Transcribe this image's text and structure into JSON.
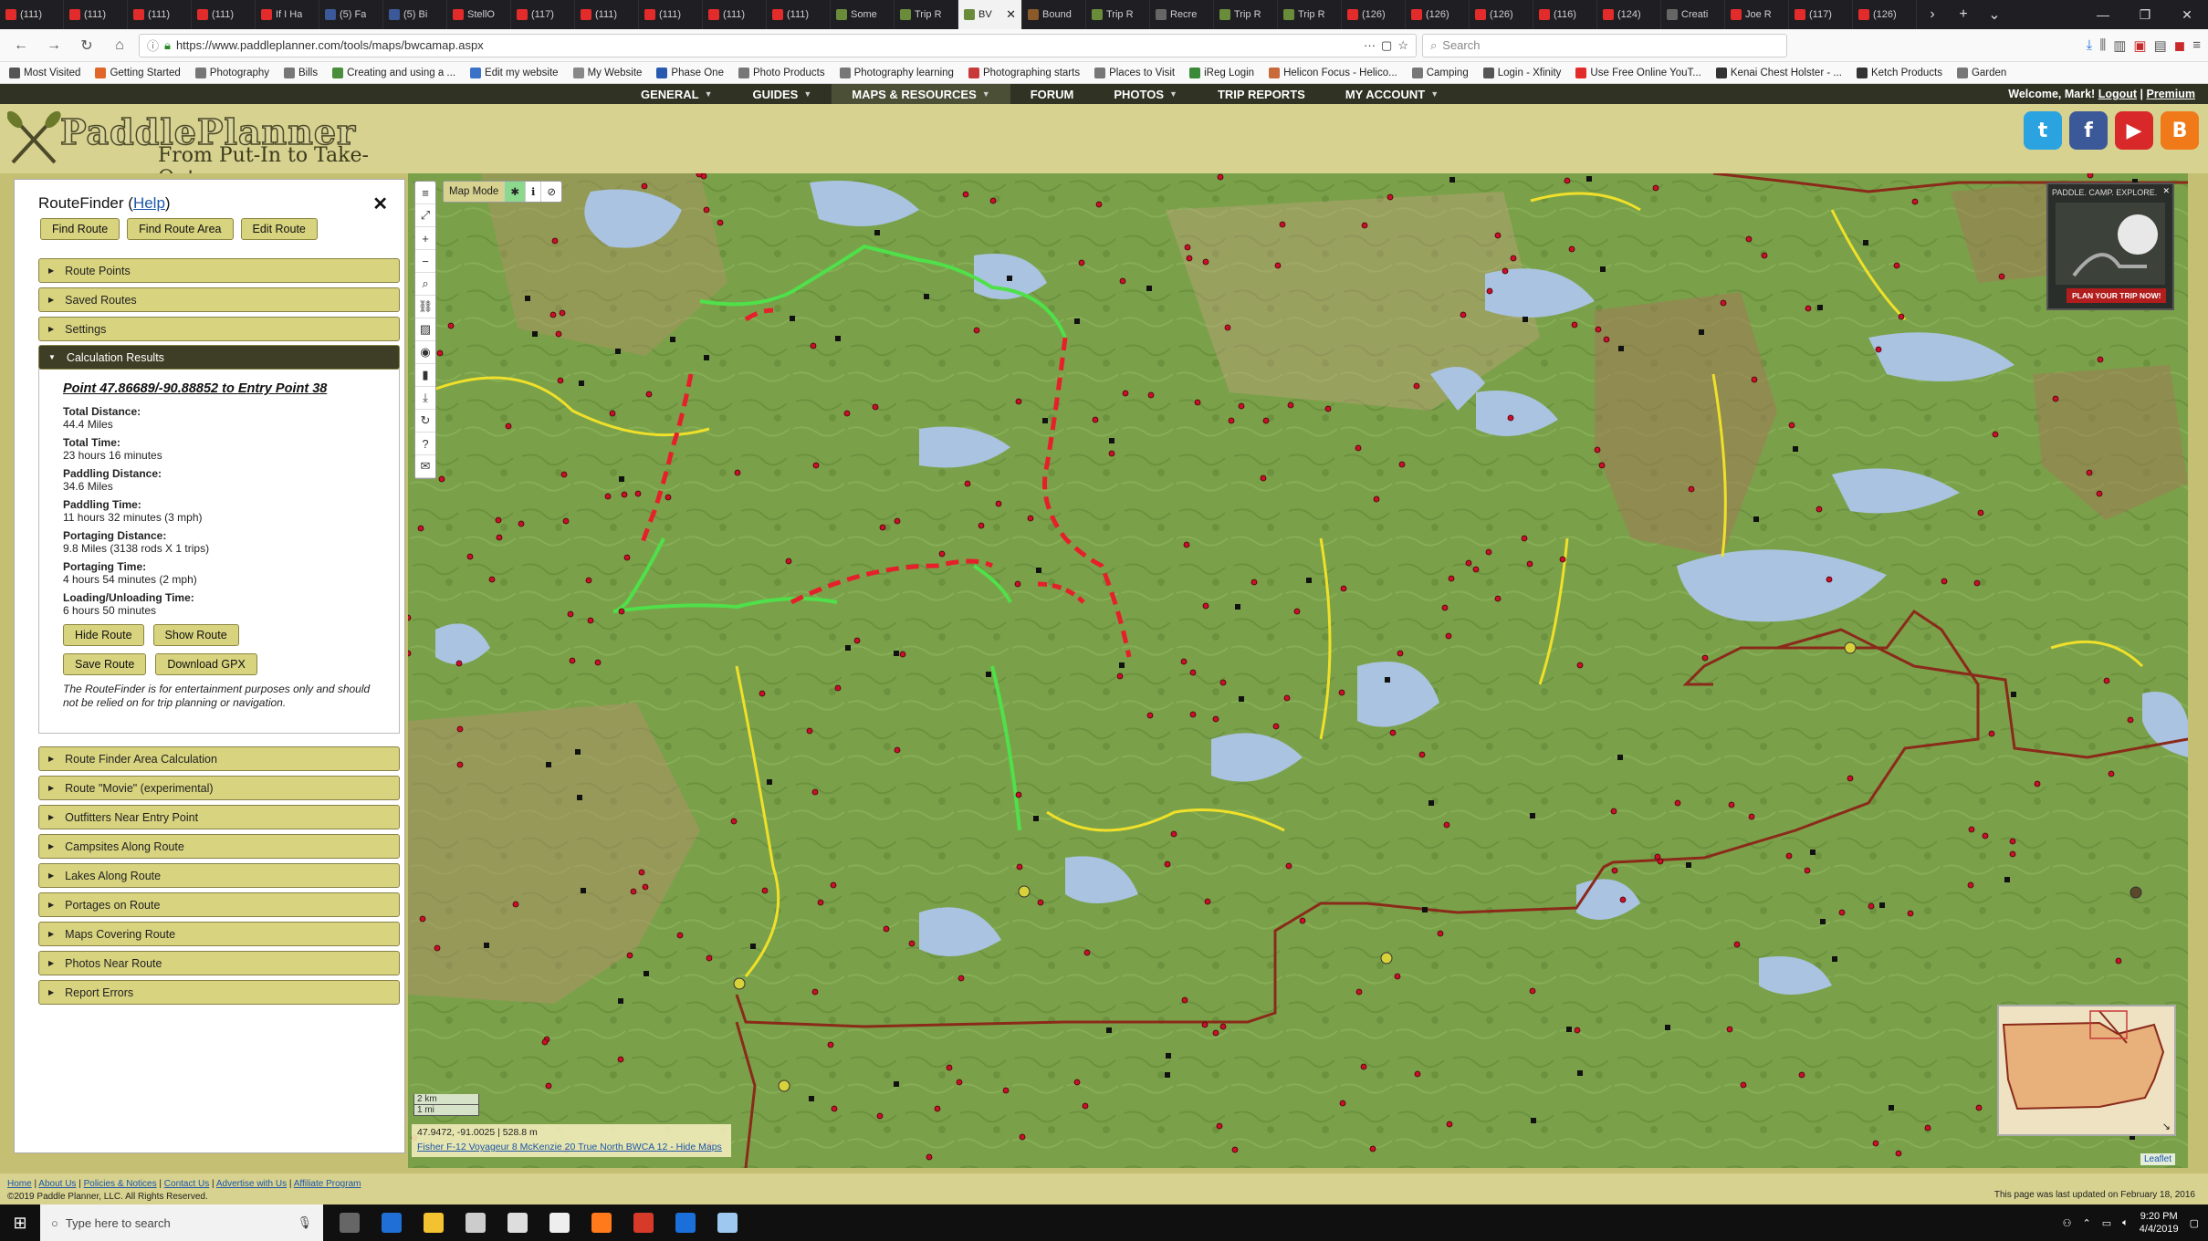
{
  "browser": {
    "tabs": [
      {
        "title": "(111)",
        "color": "#e22b2b"
      },
      {
        "title": "(111)",
        "color": "#e22b2b"
      },
      {
        "title": "(111)",
        "color": "#e22b2b"
      },
      {
        "title": "(111)",
        "color": "#e22b2b"
      },
      {
        "title": "If I Ha",
        "color": "#e22b2b"
      },
      {
        "title": "(5) Fa",
        "color": "#3b5998"
      },
      {
        "title": "(5) Bi",
        "color": "#3b5998"
      },
      {
        "title": "StellO",
        "color": "#e22b2b"
      },
      {
        "title": "(117)",
        "color": "#e22b2b"
      },
      {
        "title": "(111)",
        "color": "#e22b2b"
      },
      {
        "title": "(111)",
        "color": "#e22b2b"
      },
      {
        "title": "(111)",
        "color": "#e22b2b"
      },
      {
        "title": "(111)",
        "color": "#e22b2b"
      },
      {
        "title": "Some",
        "color": "#6a8c3a"
      },
      {
        "title": "Trip R",
        "color": "#6a8c3a"
      },
      {
        "title": "BV",
        "color": "#6a8c3a",
        "active": true
      },
      {
        "title": "Bound",
        "color": "#8a5a2a"
      },
      {
        "title": "Trip R",
        "color": "#6a8c3a"
      },
      {
        "title": "Recre",
        "color": "#666666"
      },
      {
        "title": "Trip R",
        "color": "#6a8c3a"
      },
      {
        "title": "Trip R",
        "color": "#6a8c3a"
      },
      {
        "title": "(126)",
        "color": "#e22b2b"
      },
      {
        "title": "(126)",
        "color": "#e22b2b"
      },
      {
        "title": "(126)",
        "color": "#e22b2b"
      },
      {
        "title": "(116)",
        "color": "#e22b2b"
      },
      {
        "title": "(124)",
        "color": "#e22b2b"
      },
      {
        "title": "Creati",
        "color": "#666666"
      },
      {
        "title": "Joe R",
        "color": "#e22b2b"
      },
      {
        "title": "(117)",
        "color": "#e22b2b"
      },
      {
        "title": "(126)",
        "color": "#e22b2b"
      }
    ],
    "url": "https://www.paddleplanner.com/tools/maps/bwcamap.aspx",
    "search_placeholder": "Search",
    "bookmarks": [
      {
        "label": "Most Visited",
        "color": "#555555"
      },
      {
        "label": "Getting Started",
        "color": "#e0662a"
      },
      {
        "label": "Photography",
        "color": "#777777"
      },
      {
        "label": "Bills",
        "color": "#777777"
      },
      {
        "label": "Creating and using a ...",
        "color": "#4a8d3a"
      },
      {
        "label": "Edit my website",
        "color": "#3a72c8"
      },
      {
        "label": "My Website",
        "color": "#888888"
      },
      {
        "label": "Phase One",
        "color": "#2a5ab0"
      },
      {
        "label": "Photo Products",
        "color": "#777777"
      },
      {
        "label": "Photography learning",
        "color": "#777777"
      },
      {
        "label": "Photographing starts",
        "color": "#c83a3a"
      },
      {
        "label": "Places to Visit",
        "color": "#777777"
      },
      {
        "label": "iReg Login",
        "color": "#3a8a3a"
      },
      {
        "label": "Helicon Focus - Helico...",
        "color": "#c86a3a"
      },
      {
        "label": "Camping",
        "color": "#777777"
      },
      {
        "label": "Login - Xfinity",
        "color": "#555555"
      },
      {
        "label": "Use Free Online YouT...",
        "color": "#e22b2b"
      },
      {
        "label": "Kenai Chest Holster - ...",
        "color": "#333333"
      },
      {
        "label": "Ketch Products",
        "color": "#333333"
      },
      {
        "label": "Garden",
        "color": "#777777"
      }
    ]
  },
  "site": {
    "menu": [
      {
        "label": "GENERAL",
        "caret": true
      },
      {
        "label": "GUIDES",
        "caret": true
      },
      {
        "label": "MAPS & RESOURCES",
        "caret": true,
        "active": true
      },
      {
        "label": "FORUM",
        "caret": false
      },
      {
        "label": "PHOTOS",
        "caret": true
      },
      {
        "label": "TRIP REPORTS",
        "caret": false
      },
      {
        "label": "MY ACCOUNT",
        "caret": true
      }
    ],
    "welcome": "Welcome, Mark!",
    "logout": "Logout",
    "premium": "Premium",
    "logo_title": "PaddlePlanner",
    "logo_tagline": "From Put-In to Take-Out",
    "social": [
      {
        "name": "twitter-icon",
        "glyph": "t",
        "color": "#2aa3e0"
      },
      {
        "name": "facebook-icon",
        "glyph": "f",
        "color": "#3b5998"
      },
      {
        "name": "youtube-icon",
        "glyph": "▶",
        "color": "#d8282a"
      },
      {
        "name": "blogger-icon",
        "glyph": "B",
        "color": "#f07a1a"
      }
    ]
  },
  "panel": {
    "title": "RouteFinder (",
    "help": "Help",
    "title_end": ")",
    "buttons": [
      "Find Route",
      "Find Route Area",
      "Edit Route"
    ],
    "sections_top": [
      "Route Points",
      "Saved Routes",
      "Settings"
    ],
    "open_section": "Calculation Results",
    "result_heading": "Point 47.86689/-90.88852 to Entry Point 38",
    "results": [
      {
        "label": "Total Distance:",
        "value": "44.4 Miles"
      },
      {
        "label": "Total Time:",
        "value": "23 hours 16 minutes"
      },
      {
        "label": "Paddling Distance:",
        "value": "34.6 Miles"
      },
      {
        "label": "Paddling Time:",
        "value": "11 hours 32 minutes (3 mph)"
      },
      {
        "label": "Portaging Distance:",
        "value": "9.8 Miles (3138 rods X 1 trips)"
      },
      {
        "label": "Portaging Time:",
        "value": "4 hours 54 minutes (2 mph)"
      },
      {
        "label": "Loading/Unloading Time:",
        "value": "6 hours 50 minutes"
      }
    ],
    "route_buttons_1": [
      "Hide Route",
      "Show Route"
    ],
    "route_buttons_2": [
      "Save Route",
      "Download GPX"
    ],
    "disclaimer": "The RouteFinder is for entertainment purposes only and should not be relied on for trip planning or navigation.",
    "sections_bottom": [
      "Route Finder Area Calculation",
      "Route \"Movie\" (experimental)",
      "Outfitters Near Entry Point",
      "Campsites Along Route",
      "Lakes Along Route",
      "Portages on Route",
      "Maps Covering Route",
      "Photos Near Route",
      "Report Errors"
    ]
  },
  "map": {
    "mode_label": "Map Mode",
    "ad_header": "PADDLE. CAMP. EXPLORE.",
    "ad_button": "PLAN YOUR TRIP NOW!",
    "scale_km": "2 km",
    "scale_mi": "1 mi",
    "coords": "47.9472, -91.0025 | 528.8 m",
    "map_links": "Fisher F-12 Voyageur 8 McKenzie 20 True North BWCA 12 - Hide Maps",
    "attribution": "Leaflet",
    "colors": {
      "land": "#7aa149",
      "water": "#a9c3e0",
      "route_paddle": "#4fe04a",
      "route_portage": "#e5202a",
      "boundary": "#8a2a1a",
      "trail": "#f0e02a"
    }
  },
  "footer": {
    "links": [
      "Home",
      "About Us",
      "Policies & Notices",
      "Contact Us",
      "Advertise with Us",
      "Affiliate Program"
    ],
    "copyright": "©2019 Paddle Planner, LLC. All Rights Reserved.",
    "updated": "This page was last updated on February 18, 2016"
  },
  "taskbar": {
    "search_placeholder": "Type here to search",
    "time": "9:20 PM",
    "date": "4/4/2019",
    "apps": [
      {
        "name": "task-view-icon",
        "color": "#666666"
      },
      {
        "name": "edge-icon",
        "color": "#1f6fd6"
      },
      {
        "name": "file-explorer-icon",
        "color": "#f2c230"
      },
      {
        "name": "store-icon",
        "color": "#cccccc"
      },
      {
        "name": "mail-icon",
        "color": "#dddddd"
      },
      {
        "name": "wikipedia-icon",
        "color": "#eeeeee"
      },
      {
        "name": "firefox-icon",
        "color": "#ff7a1a"
      },
      {
        "name": "app-red-icon",
        "color": "#d83a2a"
      },
      {
        "name": "photoshop-icon",
        "color": "#1a70d8"
      },
      {
        "name": "app-blue-icon",
        "color": "#9ec8f0"
      }
    ]
  }
}
